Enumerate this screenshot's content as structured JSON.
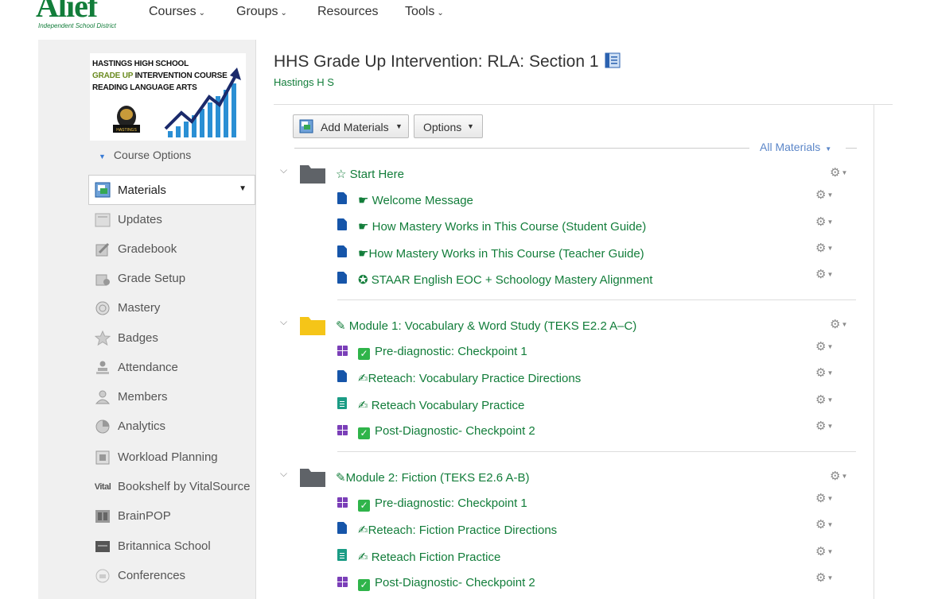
{
  "brand": {
    "name": "Alief",
    "tagline": "Independent School District"
  },
  "nav": [
    {
      "label": "Courses",
      "caret": "⌄"
    },
    {
      "label": "Groups",
      "caret": "⌄"
    },
    {
      "label": "Resources"
    },
    {
      "label": "Tools",
      "caret": "⌄"
    }
  ],
  "course_image": {
    "line1": "HASTINGS HIGH SCHOOL",
    "line2a": "GRADE UP",
    "line2b": " INTERVENTION COURSE",
    "line3": "READING LANGUAGE ARTS",
    "badge": "HASTINGS"
  },
  "sidebar": {
    "course_options": "Course Options",
    "selected": "Materials",
    "items": [
      {
        "label": "Updates",
        "icon": "updates-icon"
      },
      {
        "label": "Gradebook",
        "icon": "gradebook-icon"
      },
      {
        "label": "Grade Setup",
        "icon": "grade-setup-icon"
      },
      {
        "label": "Mastery",
        "icon": "mastery-icon"
      },
      {
        "label": "Badges",
        "icon": "badges-icon"
      },
      {
        "label": "Attendance",
        "icon": "attendance-icon"
      },
      {
        "label": "Members",
        "icon": "members-icon"
      },
      {
        "label": "Analytics",
        "icon": "analytics-icon"
      },
      {
        "label": "Workload Planning",
        "icon": "workload-icon"
      },
      {
        "label": "Bookshelf by VitalSource",
        "icon": "vitalsource-icon",
        "icon_text": "Vital"
      },
      {
        "label": "BrainPOP",
        "icon": "brainpop-icon"
      },
      {
        "label": "Britannica School",
        "icon": "britannica-icon"
      },
      {
        "label": "Conferences",
        "icon": "conferences-icon"
      }
    ]
  },
  "main": {
    "title": "HHS Grade Up Intervention: RLA: Section 1",
    "school": "Hastings H S",
    "add_materials": "Add Materials",
    "options": "Options",
    "filter": "All Materials",
    "gear": "⚙"
  },
  "folders": [
    {
      "title": "☆ Start Here",
      "color": "#5f6368",
      "items": [
        {
          "type": "page",
          "title": "☛ Welcome Message"
        },
        {
          "type": "page",
          "title": "☛ How Mastery Works in This Course (Student Guide)"
        },
        {
          "type": "page",
          "title": "☛How Mastery Works in This Course (Teacher Guide)"
        },
        {
          "type": "page",
          "title": "✪ STAAR English EOC + Schoology Mastery Alignment"
        }
      ]
    },
    {
      "title": "✎ Module 1: Vocabulary & Word Study (TEKS E2.2 A–C)",
      "color": "#f5c518",
      "items": [
        {
          "type": "assessment",
          "title": "Pre-diagnostic: Checkpoint 1",
          "prefix": "✓"
        },
        {
          "type": "page",
          "title": "✍Reteach: Vocabulary Practice Directions"
        },
        {
          "type": "assignment",
          "title": "✍ Reteach Vocabulary Practice"
        },
        {
          "type": "assessment",
          "title": "Post-Diagnostic- Checkpoint 2",
          "prefix": "✓"
        }
      ]
    },
    {
      "title": "✎Module 2: Fiction (TEKS E2.6 A-B)",
      "color": "#5f6368",
      "items": [
        {
          "type": "assessment",
          "title": "Pre-diagnostic: Checkpoint 1",
          "prefix": "✓"
        },
        {
          "type": "page",
          "title": "✍Reteach: Fiction Practice Directions"
        },
        {
          "type": "assignment",
          "title": "✍ Reteach Fiction Practice"
        },
        {
          "type": "assessment",
          "title": "Post-Diagnostic- Checkpoint 2",
          "prefix": "✓"
        }
      ]
    }
  ]
}
